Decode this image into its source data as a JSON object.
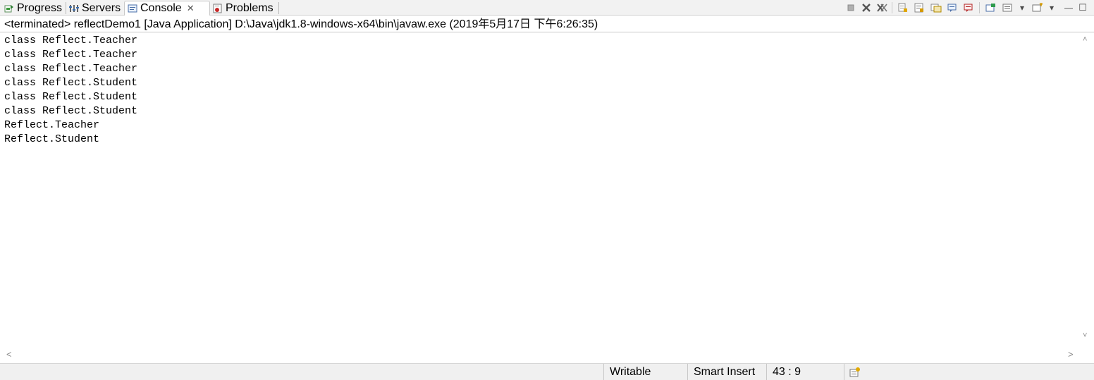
{
  "tabs": [
    {
      "label": "Progress",
      "icon": "progress-icon"
    },
    {
      "label": "Servers",
      "icon": "servers-icon"
    },
    {
      "label": "Console",
      "icon": "console-icon",
      "active": true,
      "close": "✕"
    },
    {
      "label": "Problems",
      "icon": "problems-icon"
    }
  ],
  "toolbar": {
    "icons": [
      "terminate-icon",
      "remove-launch-icon",
      "remove-all-terminated-icon",
      "scroll-lock-icon",
      "word-wrap-icon",
      "show-on-stdout-icon",
      "show-on-stderr-icon",
      "pin-console-icon",
      "display-console-icon",
      "open-console-icon",
      "minimize-icon",
      "maximize-icon"
    ],
    "minimize_glyph": "—",
    "maximize_glyph": "☐",
    "dropdown_glyph": "▾"
  },
  "header": {
    "text": "<terminated> reflectDemo1 [Java Application] D:\\Java\\jdk1.8-windows-x64\\bin\\javaw.exe (2019年5月17日 下午6:26:35)"
  },
  "console": {
    "lines": [
      "class Reflect.Teacher",
      "class Reflect.Teacher",
      "class Reflect.Teacher",
      "class Reflect.Student",
      "class Reflect.Student",
      "class Reflect.Student",
      "Reflect.Teacher",
      "Reflect.Student"
    ]
  },
  "scrollbars": {
    "up": "˄",
    "down": "˅",
    "left": "<",
    "right": ">"
  },
  "statusbar": {
    "writable": "Writable",
    "insert_mode": "Smart Insert",
    "position": "43 : 9",
    "icon": "mode-icon"
  },
  "colors": {
    "tabbar_bg": "#f2f2f2",
    "statusbar_bg": "#f0f0f0",
    "terminate_red": "#b22222"
  }
}
